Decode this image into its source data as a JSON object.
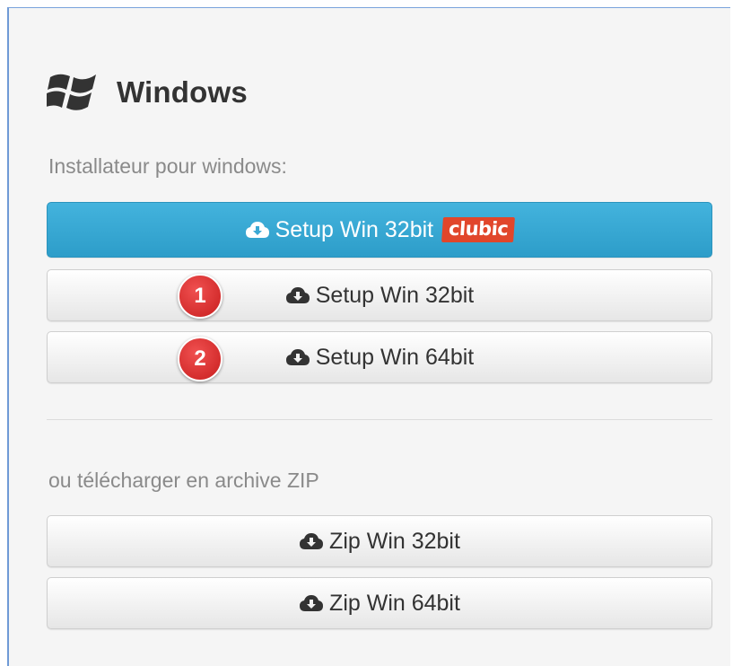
{
  "section": {
    "title": "Windows",
    "icon": "windows-logo-icon"
  },
  "installer": {
    "label": "Installateur pour windows:",
    "primary_button": {
      "label": "Setup Win 32bit",
      "icon": "cloud-download-icon",
      "badge": "clubic",
      "color": "#3aa8d4"
    },
    "buttons": [
      {
        "marker": "1",
        "label": "Setup Win 32bit",
        "icon": "cloud-download-icon"
      },
      {
        "marker": "2",
        "label": "Setup Win 64bit",
        "icon": "cloud-download-icon"
      }
    ]
  },
  "archive": {
    "label": "ou télécharger en archive ZIP",
    "buttons": [
      {
        "label": "Zip Win 32bit",
        "icon": "cloud-download-icon"
      },
      {
        "label": "Zip Win 64bit",
        "icon": "cloud-download-icon"
      }
    ]
  },
  "colors": {
    "marker_red": "#d42a2a",
    "clubic_red": "#e1462b",
    "primary_blue": "#3aa8d4"
  }
}
